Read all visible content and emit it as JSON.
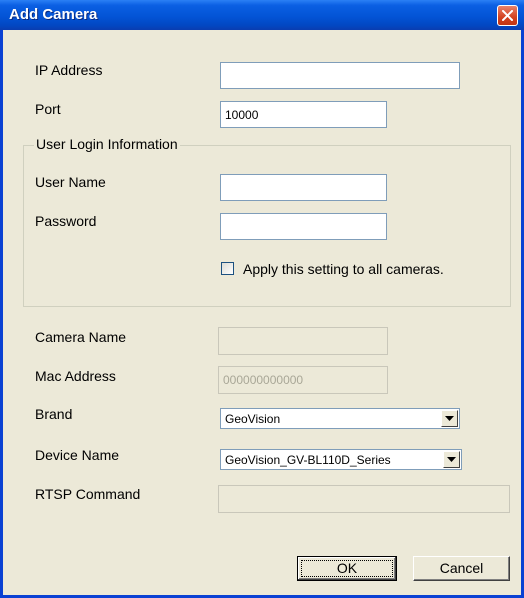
{
  "window": {
    "title": "Add Camera"
  },
  "form": {
    "ip_address": {
      "label": "IP Address",
      "value": ""
    },
    "port": {
      "label": "Port",
      "value": "10000"
    },
    "login_group": {
      "legend": "User Login Information",
      "user_name": {
        "label": "User Name",
        "value": ""
      },
      "password": {
        "label": "Password",
        "value": ""
      },
      "apply_all": {
        "label": "Apply this setting to all cameras.",
        "checked": false
      }
    },
    "camera_name": {
      "label": "Camera Name",
      "value": ""
    },
    "mac_address": {
      "label": "Mac Address",
      "value": "000000000000"
    },
    "brand": {
      "label": "Brand",
      "value": "GeoVision"
    },
    "device_name": {
      "label": "Device Name",
      "value": "GeoVision_GV-BL110D_Series"
    },
    "rtsp_command": {
      "label": "RTSP Command",
      "value": ""
    }
  },
  "buttons": {
    "ok": "OK",
    "cancel": "Cancel"
  },
  "colors": {
    "titlebar": "#0354d6",
    "dialog_bg": "#ece9d8",
    "close_button": "#d3421f",
    "field_border": "#7f9db9"
  },
  "icons": {
    "close": "close-icon",
    "dropdown": "chevron-down-icon"
  }
}
